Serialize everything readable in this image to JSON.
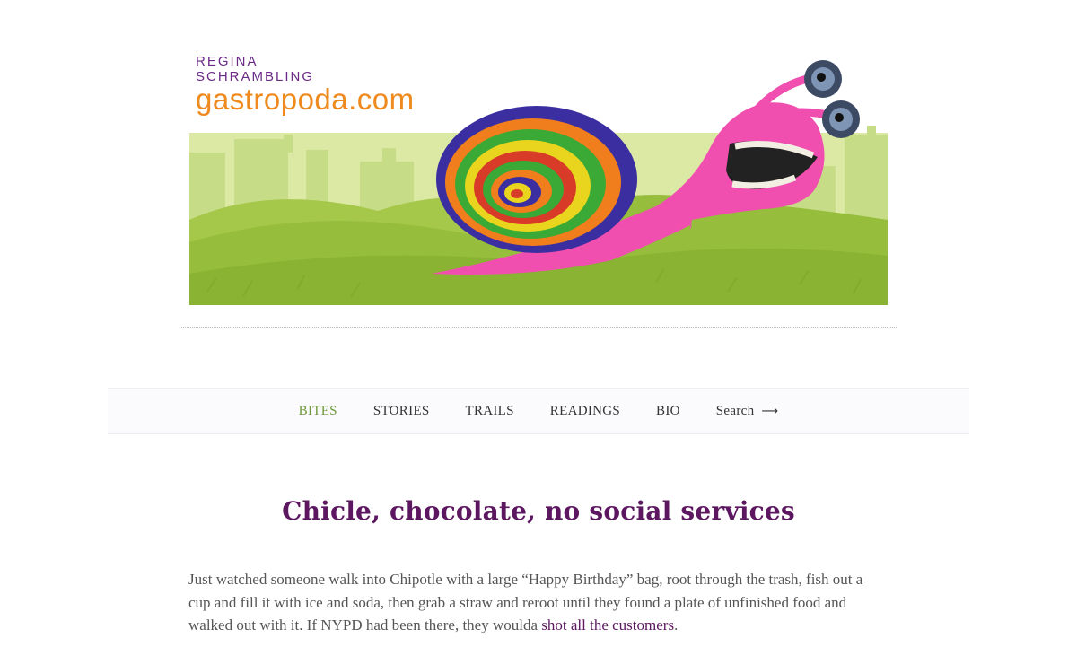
{
  "brand": {
    "line1": "REGINA",
    "line2": "SCHRAMBLING",
    "domain": "gastropoda.com"
  },
  "nav": {
    "items": [
      {
        "label": "BITES",
        "active": true
      },
      {
        "label": "STORIES",
        "active": false
      },
      {
        "label": "TRAILS",
        "active": false
      },
      {
        "label": "READINGS",
        "active": false
      },
      {
        "label": "BIO",
        "active": false
      }
    ],
    "search_label": "Search",
    "search_icon": "arrow-right-icon"
  },
  "post": {
    "title": "Chicle, chocolate, no social services",
    "body_text": "Just watched someone walk into Chipotle with a large “Happy Birthday” bag, root through the trash, fish out a cup and fill it with ice and soda, then grab a straw and reroot until they found a plate of unfinished food and walked out with it. If NYPD had been there, they woulda ",
    "link_text": "shot all the customers",
    "body_end": "."
  },
  "colors": {
    "brand_purple": "#6a2a86",
    "brand_orange": "#ef8a1f",
    "nav_active": "#6f9a3b",
    "title": "#5c1760"
  }
}
